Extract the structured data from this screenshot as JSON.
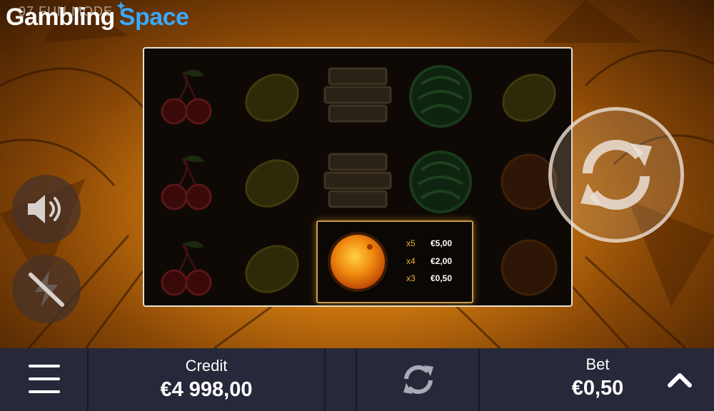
{
  "brand": {
    "word1": "Gambling",
    "word2": "Space"
  },
  "overlay_text": "97 FUN MODE",
  "paytable": {
    "symbol": "orange-icon",
    "rows": [
      {
        "mult": "x5",
        "amount": "€5,00"
      },
      {
        "mult": "x4",
        "amount": "€2,00"
      },
      {
        "mult": "x3",
        "amount": "€0,50"
      }
    ]
  },
  "reels": [
    [
      "cherry-icon",
      "cherry-icon",
      "cherry-icon"
    ],
    [
      "lemon-icon",
      "lemon-icon",
      "lemon-icon"
    ],
    [
      "bar-icon",
      "bar-icon",
      "orange-icon"
    ],
    [
      "watermelon-icon",
      "watermelon-icon",
      "orange-icon"
    ],
    [
      "lemon-icon",
      "orange-icon",
      "orange-icon"
    ]
  ],
  "controls": {
    "sound_icon": "speaker-icon",
    "turbo_icon": "lightning-off-icon",
    "spin_icon": "refresh-icon"
  },
  "footer": {
    "menu_icon": "hamburger-icon",
    "credit_label": "Credit",
    "credit_value": "€4 998,00",
    "autoplay_icon": "refresh-icon",
    "bet_label": "Bet",
    "bet_value": "€0,50",
    "bet_expand_icon": "chevron-up-icon"
  },
  "colors": {
    "accent": "#3aa8ff",
    "gold": "#f0b030",
    "footer": "#27293a"
  }
}
